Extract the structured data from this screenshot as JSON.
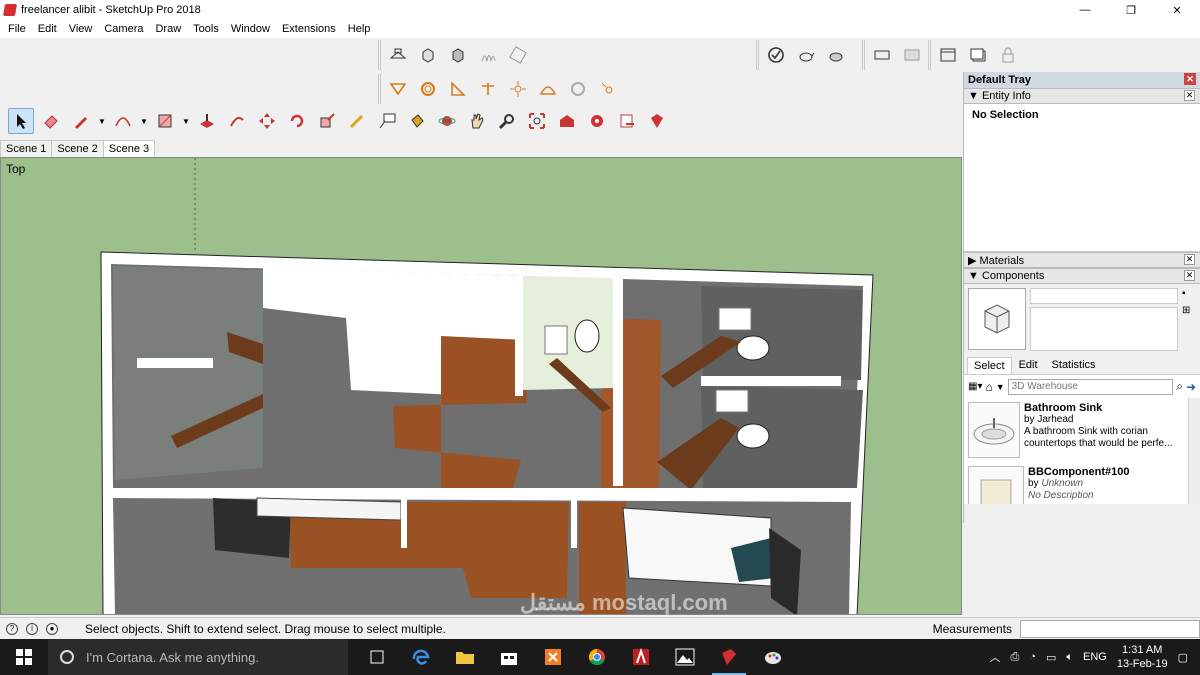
{
  "window": {
    "title": "freelancer alibit - SketchUp Pro 2018",
    "controls": {
      "minimize": "—",
      "maximize": "❐",
      "close": "✕"
    }
  },
  "menu": [
    "File",
    "Edit",
    "View",
    "Camera",
    "Draw",
    "Tools",
    "Window",
    "Extensions",
    "Help"
  ],
  "scenes": {
    "tabs": [
      "Scene 1",
      "Scene 2",
      "Scene 3"
    ],
    "active_index": 2
  },
  "viewport": {
    "view_label": "Top",
    "background": "#9cbf8b"
  },
  "tray": {
    "title": "Default Tray",
    "entity_info": {
      "label": "Entity Info",
      "selection": "No Selection"
    },
    "materials": {
      "label": "Materials"
    },
    "components": {
      "label": "Components",
      "tabs": [
        "Select",
        "Edit",
        "Statistics"
      ],
      "search_placeholder": "3D Warehouse",
      "items": [
        {
          "name": "Bathroom Sink",
          "by": "by Jarhead",
          "desc": "A bathroom Sink with corian countertops that would be perfe..."
        },
        {
          "name": "BBComponent#100",
          "by": "by",
          "author": "Unknown",
          "desc": "No Description"
        }
      ]
    }
  },
  "status": {
    "message": "Select objects. Shift to extend select. Drag mouse to select multiple.",
    "measurements_label": "Measurements",
    "measurements_value": ""
  },
  "taskbar": {
    "search_placeholder": "I'm Cortana. Ask me anything.",
    "language": "ENG",
    "time": "1:31 AM",
    "date": "13-Feb-19"
  },
  "watermark": "مستقل mostaql.com",
  "colors": {
    "viewport_bg": "#9cbf8b",
    "floor_wood": "#8b4a1f",
    "tile_gray": "#6e6e6e",
    "taskbar": "#1a1a1a",
    "accent_red": "#d32f2f"
  }
}
